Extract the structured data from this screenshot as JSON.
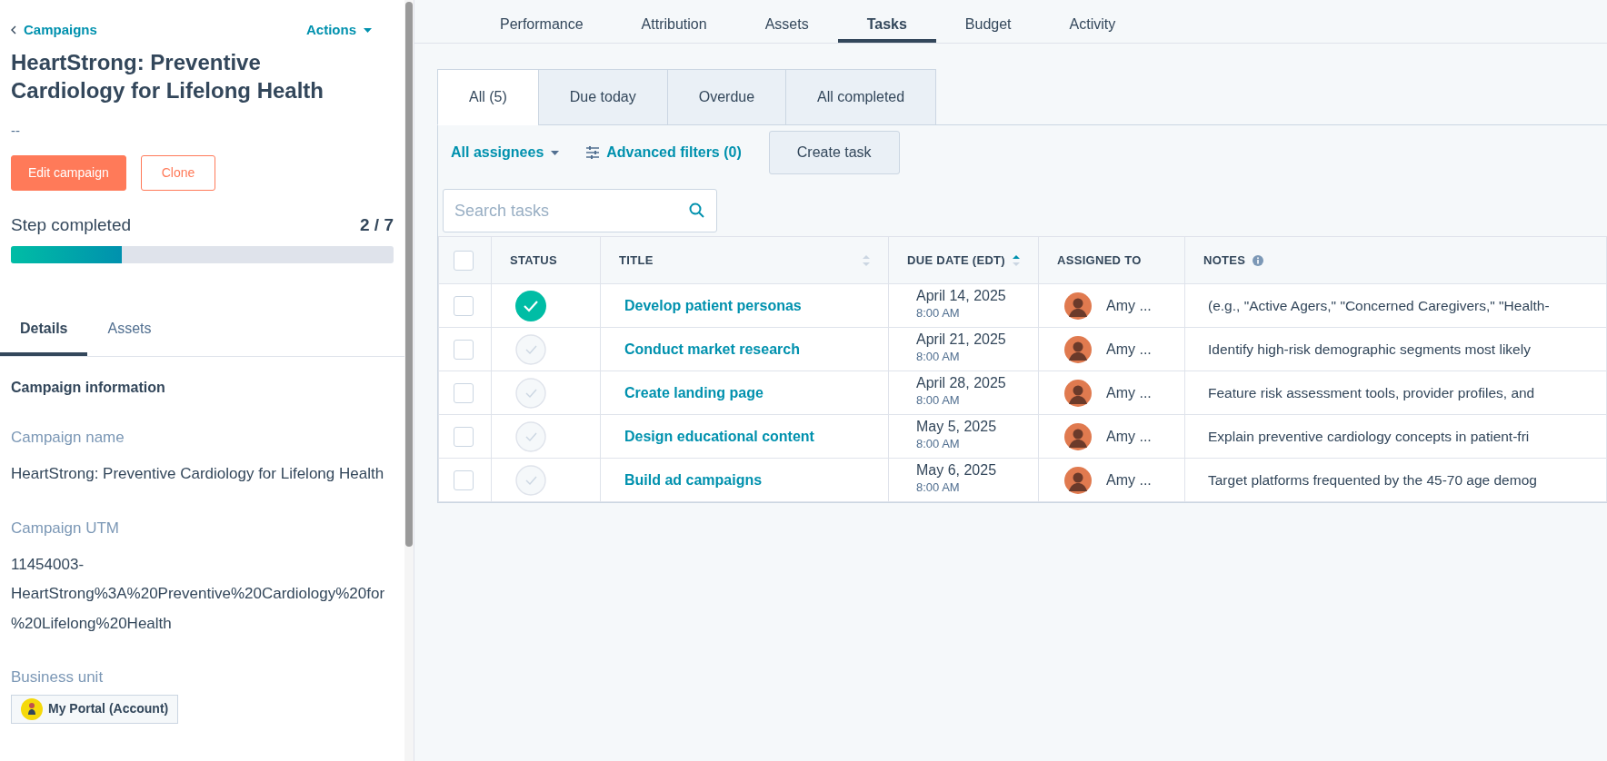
{
  "sidebar": {
    "back_link": "Campaigns",
    "actions": "Actions",
    "title": "HeartStrong: Preventive Cardiology for Lifelong Health",
    "description": "--",
    "buttons": [
      {
        "label": "Edit campaign",
        "kind": "primary"
      },
      {
        "label": "Clone",
        "kind": "secondary"
      }
    ],
    "progress": {
      "label": "Step completed",
      "reading": "2 / 7",
      "level": 0.29
    },
    "tabs": [
      {
        "label": "Details",
        "selected": true
      },
      {
        "label": "Assets",
        "selected": false
      }
    ],
    "section_title": "Campaign information",
    "fields": [
      {
        "label": "Campaign name",
        "value": "HeartStrong: Preventive Cardiology for Lifelong Health",
        "kind": "text"
      },
      {
        "label": "Campaign UTM",
        "value": "11454003-HeartStrong%3A%20Preventive%20Cardiology%20for%20Lifelong%20Health",
        "kind": "text"
      },
      {
        "label": "Business unit",
        "value": "My Portal (Account)",
        "kind": "tag"
      }
    ]
  },
  "nav_tabs": [
    {
      "label": "Performance",
      "selected": false
    },
    {
      "label": "Attribution",
      "selected": false
    },
    {
      "label": "Assets",
      "selected": false
    },
    {
      "label": "Tasks",
      "selected": true
    },
    {
      "label": "Budget",
      "selected": false
    },
    {
      "label": "Activity",
      "selected": false
    }
  ],
  "task_tabs": [
    {
      "label": "All (5)",
      "selected": true
    },
    {
      "label": "Due today",
      "selected": false
    },
    {
      "label": "Overdue",
      "selected": false
    },
    {
      "label": "All completed",
      "selected": false
    }
  ],
  "filters": {
    "assignees": "All assignees",
    "advanced": "Advanced filters (0)",
    "create": "Create task"
  },
  "search": {
    "placeholder": "Search tasks"
  },
  "table": {
    "select_all_checked": false,
    "columns": [
      "STATUS",
      "TITLE",
      "DUE DATE (EDT)",
      "ASSIGNED TO",
      "NOTES"
    ],
    "rows": [
      {
        "checked": false,
        "completed": true,
        "title": "Develop patient personas",
        "date": "April 14, 2025",
        "time": "8:00 AM",
        "assignee": "Amy ...",
        "notes": "(e.g., \"Active Agers,\" \"Concerned Caregivers,\" \"Health-"
      },
      {
        "checked": false,
        "completed": false,
        "title": "Conduct market research",
        "date": "April 21, 2025",
        "time": "8:00 AM",
        "assignee": "Amy ...",
        "notes": "Identify high-risk demographic segments most likely"
      },
      {
        "checked": false,
        "completed": false,
        "title": "Create landing page",
        "date": "April 28, 2025",
        "time": "8:00 AM",
        "assignee": "Amy ...",
        "notes": "Feature risk assessment tools, provider profiles, and"
      },
      {
        "checked": false,
        "completed": false,
        "title": "Design educational content",
        "date": "May 5, 2025",
        "time": "8:00 AM",
        "assignee": "Amy ...",
        "notes": "Explain preventive cardiology concepts in patient-fri"
      },
      {
        "checked": false,
        "completed": false,
        "title": "Build ad campaigns",
        "date": "May 6, 2025",
        "time": "8:00 AM",
        "assignee": "Amy ...",
        "notes": "Target platforms frequented by the 45-70 age demog"
      }
    ]
  }
}
